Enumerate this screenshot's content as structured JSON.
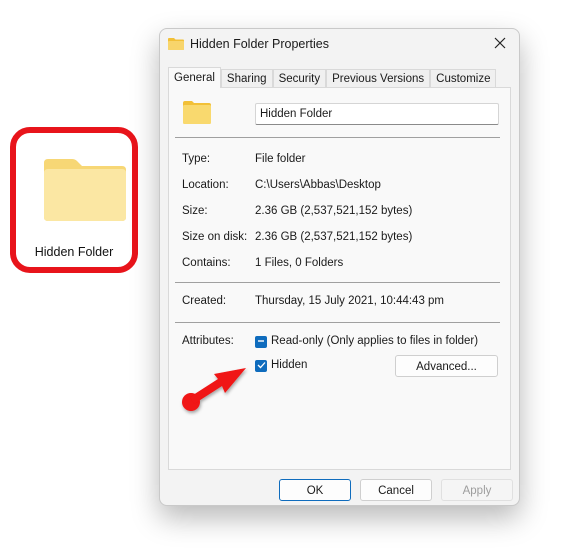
{
  "desktop": {
    "folder_label": "Hidden Folder",
    "highlight_color": "#e8141b"
  },
  "dialog": {
    "title": "Hidden Folder Properties",
    "close_icon": "close-icon",
    "tabs": [
      {
        "label": "General",
        "active": true
      },
      {
        "label": "Sharing",
        "active": false
      },
      {
        "label": "Security",
        "active": false
      },
      {
        "label": "Previous Versions",
        "active": false
      },
      {
        "label": "Customize",
        "active": false
      }
    ],
    "name_value": "Hidden Folder",
    "info": [
      {
        "label": "Type:",
        "value": "File folder"
      },
      {
        "label": "Location:",
        "value": "C:\\Users\\Abbas\\Desktop"
      },
      {
        "label": "Size:",
        "value": "2.36 GB (2,537,521,152 bytes)"
      },
      {
        "label": "Size on disk:",
        "value": "2.36 GB (2,537,521,152 bytes)"
      },
      {
        "label": "Contains:",
        "value": "1 Files, 0 Folders"
      }
    ],
    "created": {
      "label": "Created:",
      "value": "Thursday, 15 July 2021, 10:44:43 pm"
    },
    "attributes": {
      "label": "Attributes:",
      "readonly": {
        "label": "Read-only (Only applies to files in folder)",
        "state": "indeterminate"
      },
      "hidden": {
        "label": "Hidden",
        "state": "checked"
      },
      "advanced_button": "Advanced..."
    },
    "buttons": {
      "ok": "OK",
      "cancel": "Cancel",
      "apply": "Apply"
    },
    "accent_color": "#0f6cbd"
  },
  "annotation": {
    "arrow_color": "#e8141b"
  }
}
